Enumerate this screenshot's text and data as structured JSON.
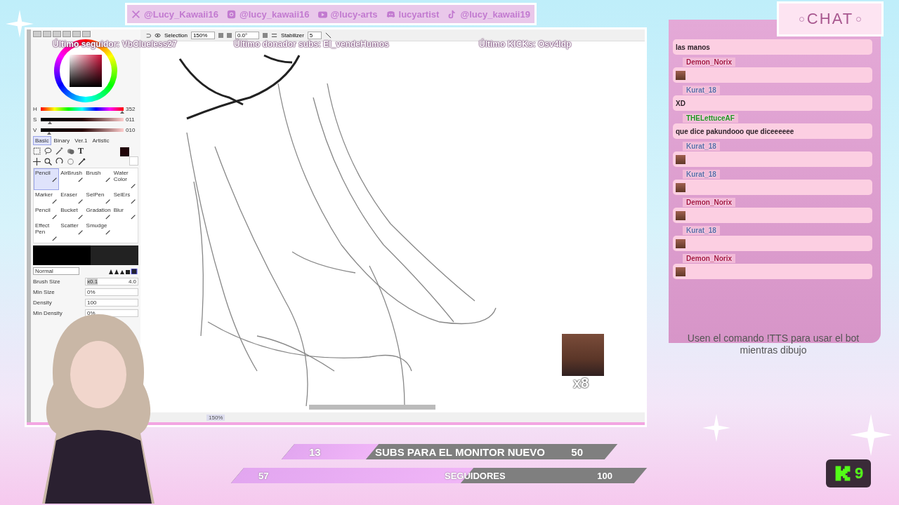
{
  "social_bar": [
    {
      "kind": "x",
      "handle": "@Lucy_Kawaii16"
    },
    {
      "kind": "instagram",
      "handle": "@lucy_kawaii16"
    },
    {
      "kind": "youtube",
      "handle": "@lucy-arts"
    },
    {
      "kind": "discord",
      "handle": "lucyartist"
    },
    {
      "kind": "tiktok",
      "handle": "@lucy_kawaii19"
    }
  ],
  "paint_app": {
    "toolbar": {
      "selection_label": "Selection",
      "zoom": "150%",
      "rotation": "0.0°",
      "stabilizer_label": "Stabilizer",
      "stabilizer": "5"
    },
    "color_sliders": [
      {
        "label": "H",
        "value": "352",
        "level": 0.98
      },
      {
        "label": "S",
        "value": "011",
        "level": 0.11
      },
      {
        "label": "V",
        "value": "010",
        "level": 0.1
      }
    ],
    "tool_tabs": [
      {
        "label": "Basic",
        "selected": true
      },
      {
        "label": "Binary",
        "selected": false
      },
      {
        "label": "Ver.1",
        "selected": false
      },
      {
        "label": "Artistic",
        "selected": false
      }
    ],
    "text_tool_glyph": "T",
    "brushes": [
      {
        "label": "Pencil",
        "selected": true
      },
      {
        "label": "AirBrush",
        "selected": false
      },
      {
        "label": "Brush",
        "selected": false
      },
      {
        "label": "Water Color",
        "selected": false
      },
      {
        "label": "Marker",
        "selected": false
      },
      {
        "label": "Eraser",
        "selected": false
      },
      {
        "label": "SelPen",
        "selected": false
      },
      {
        "label": "SelErs",
        "selected": false
      },
      {
        "label": "Pencil",
        "selected": false
      },
      {
        "label": "Bucket",
        "selected": false
      },
      {
        "label": "Gradation",
        "selected": false
      },
      {
        "label": "Blur",
        "selected": false
      },
      {
        "label": "Effect Pen",
        "selected": false
      },
      {
        "label": "Scatter",
        "selected": false
      },
      {
        "label": "Smudge",
        "selected": false
      }
    ],
    "blend_mode": "Normal",
    "brush_settings": [
      {
        "label": "Brush Size",
        "multiplier": "x0.1",
        "value": "4.0"
      },
      {
        "label": "Min Size",
        "value": "0%"
      },
      {
        "label": "Density",
        "value": "100"
      },
      {
        "label": "Min Density",
        "value": "0%"
      }
    ],
    "status_zoom": "150%"
  },
  "stream_overlay": {
    "alerts": [
      "Último seguidor: VbClueless27",
      "Último donador subs: El_vendeHumos",
      "Último KICKs: Osv4ldp"
    ],
    "emote_count": "x8"
  },
  "chat": {
    "title": "CHAT",
    "messages": [
      {
        "kind": "text",
        "text": "las manos"
      },
      {
        "kind": "emote",
        "user": "Demon_Norix",
        "color": "#a3123f"
      },
      {
        "kind": "text",
        "user": "Kurat_18",
        "color": "#5b6aa6",
        "text": "XD"
      },
      {
        "kind": "text",
        "user": "THELettuceAF",
        "color": "#1d8f1d",
        "text": "que dice pakundooo que diceeeeee"
      },
      {
        "kind": "emote",
        "user": "Kurat_18",
        "color": "#5b6aa6"
      },
      {
        "kind": "emote",
        "user": "Kurat_18",
        "color": "#5b6aa6"
      },
      {
        "kind": "emote",
        "user": "Demon_Norix",
        "color": "#a3123f"
      },
      {
        "kind": "emote",
        "user": "Kurat_18",
        "color": "#5b6aa6"
      },
      {
        "kind": "emote",
        "user": "Demon_Norix",
        "color": "#a3123f"
      }
    ]
  },
  "tts_notice": "Usen el comando !TTS para usar el bot mientras dibujo",
  "goals": [
    {
      "current": "13",
      "label": "SUBS PARA EL MONITOR NUEVO",
      "target": "50",
      "level": 0.26
    },
    {
      "current": "57",
      "label": "SEGUIDORES",
      "target": "100",
      "level": 0.57
    }
  ],
  "kick_badge": {
    "count": "9"
  }
}
